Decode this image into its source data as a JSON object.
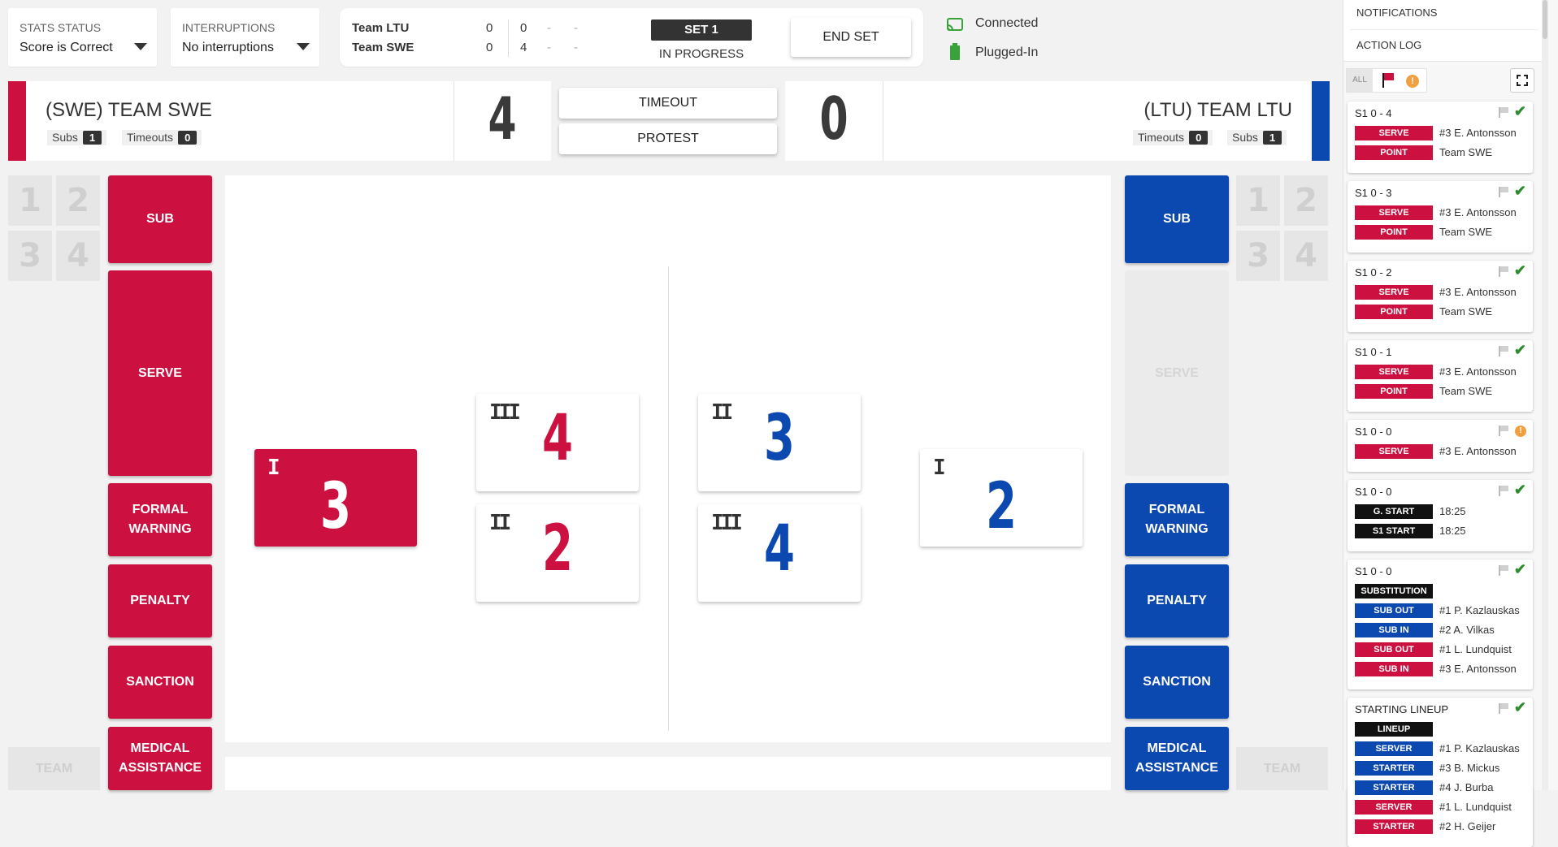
{
  "top": {
    "stats_status": {
      "label": "STATS STATUS",
      "value": "Score is Correct"
    },
    "interruptions": {
      "label": "INTERRUPTIONS",
      "value": "No interruptions"
    },
    "scoreboard": {
      "rows": [
        {
          "team": "Team LTU",
          "sets": "0",
          "s1": "0",
          "s2": "-",
          "s3": "-"
        },
        {
          "team": "Team SWE",
          "sets": "0",
          "s1": "4",
          "s2": "-",
          "s3": "-"
        }
      ],
      "set_badge": "SET 1",
      "set_state": "IN PROGRESS"
    },
    "end_set_label": "END SET",
    "connection": "Connected",
    "power": "Plugged-In"
  },
  "left_team": {
    "name": "(SWE) TEAM SWE",
    "subs_label": "Subs",
    "subs": "1",
    "timeouts_label": "Timeouts",
    "timeouts": "0",
    "score": "4",
    "color": "#cc1040"
  },
  "right_team": {
    "name": "(LTU) TEAM LTU",
    "subs_label": "Subs",
    "subs": "1",
    "timeouts_label": "Timeouts",
    "timeouts": "0",
    "score": "0",
    "color": "#0b48b0"
  },
  "center_buttons": {
    "timeout": "TIMEOUT",
    "protest": "PROTEST"
  },
  "rotation_numbers": [
    "1",
    "2",
    "3",
    "4"
  ],
  "team_label": "TEAM",
  "left_actions": {
    "sub": "SUB",
    "serve": "SERVE",
    "formal_warning": "FORMAL WARNING",
    "penalty": "PENALTY",
    "sanction": "SANCTION",
    "medical": "MEDICAL ASSISTANCE"
  },
  "right_actions": {
    "sub": "SUB",
    "serve": "SERVE",
    "formal_warning": "FORMAL WARNING",
    "penalty": "PENALTY",
    "sanction": "SANCTION",
    "medical": "MEDICAL ASSISTANCE"
  },
  "court": {
    "left_server": {
      "pos": "I",
      "num": "3"
    },
    "left_front_top": {
      "pos": "III",
      "num": "4"
    },
    "left_front_bottom": {
      "pos": "II",
      "num": "2"
    },
    "right_front_top": {
      "pos": "II",
      "num": "3"
    },
    "right_front_bottom": {
      "pos": "III",
      "num": "4"
    },
    "right_back": {
      "pos": "I",
      "num": "2"
    }
  },
  "side_panel": {
    "notifications": "NOTIFICATIONS",
    "action_log": "ACTION LOG",
    "filter_all": "ALL",
    "log": [
      {
        "title": "S1  0 - 4",
        "status": "ok",
        "rows": [
          {
            "tag": "SERVE",
            "color": "red",
            "text": "#3 E. Antonsson"
          },
          {
            "tag": "POINT",
            "color": "red",
            "text": "Team SWE"
          }
        ]
      },
      {
        "title": "S1  0 - 3",
        "status": "ok",
        "rows": [
          {
            "tag": "SERVE",
            "color": "red",
            "text": "#3 E. Antonsson"
          },
          {
            "tag": "POINT",
            "color": "red",
            "text": "Team SWE"
          }
        ]
      },
      {
        "title": "S1  0 - 2",
        "status": "ok",
        "rows": [
          {
            "tag": "SERVE",
            "color": "red",
            "text": "#3 E. Antonsson"
          },
          {
            "tag": "POINT",
            "color": "red",
            "text": "Team SWE"
          }
        ]
      },
      {
        "title": "S1  0 - 1",
        "status": "ok",
        "rows": [
          {
            "tag": "SERVE",
            "color": "red",
            "text": "#3 E. Antonsson"
          },
          {
            "tag": "POINT",
            "color": "red",
            "text": "Team SWE"
          }
        ]
      },
      {
        "title": "S1  0 - 0",
        "status": "warn",
        "rows": [
          {
            "tag": "SERVE",
            "color": "red",
            "text": "#3 E. Antonsson"
          }
        ]
      },
      {
        "title": "S1  0 - 0",
        "status": "ok",
        "rows": [
          {
            "tag": "G. START",
            "color": "black",
            "text": "18:25"
          },
          {
            "tag": "S1 START",
            "color": "black",
            "text": "18:25"
          }
        ]
      },
      {
        "title": "S1  0 - 0",
        "status": "ok",
        "rows": [
          {
            "tag": "SUBSTITUTION",
            "color": "black",
            "text": ""
          },
          {
            "tag": "SUB OUT",
            "color": "blue",
            "text": "#1 P. Kazlauskas"
          },
          {
            "tag": "SUB IN",
            "color": "blue",
            "text": "#2 A. Vilkas"
          },
          {
            "tag": "SUB OUT",
            "color": "red",
            "text": "#1 L. Lundquist"
          },
          {
            "tag": "SUB IN",
            "color": "red",
            "text": "#3 E. Antonsson"
          }
        ]
      },
      {
        "title": "STARTING LINEUP",
        "status": "ok",
        "rows": [
          {
            "tag": "LINEUP",
            "color": "black",
            "text": ""
          },
          {
            "tag": "SERVER",
            "color": "blue",
            "text": "#1 P. Kazlauskas"
          },
          {
            "tag": "STARTER",
            "color": "blue",
            "text": "#3 B. Mickus"
          },
          {
            "tag": "STARTER",
            "color": "blue",
            "text": "#4 J. Burba"
          },
          {
            "tag": "SERVER",
            "color": "red",
            "text": "#1 L. Lundquist"
          },
          {
            "tag": "STARTER",
            "color": "red",
            "text": "#2 H. Geijer"
          }
        ]
      }
    ]
  }
}
